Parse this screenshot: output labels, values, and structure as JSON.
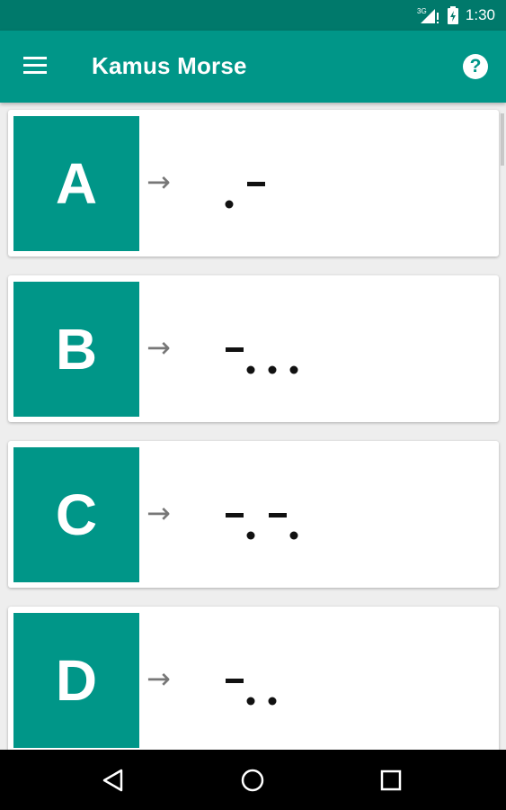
{
  "status_bar": {
    "network": "3G",
    "time": "1:30"
  },
  "app_bar": {
    "title": "Kamus Morse",
    "menu_icon": "hamburger-menu-icon",
    "help_icon": "help-circle-icon",
    "color": "#009688"
  },
  "arrow": "→",
  "entries": [
    {
      "letter": "A",
      "code": ".-"
    },
    {
      "letter": "B",
      "code": "-..."
    },
    {
      "letter": "C",
      "code": "-.-."
    },
    {
      "letter": "D",
      "code": "-.."
    }
  ],
  "nav_bar": {
    "back_icon": "back-triangle-icon",
    "home_icon": "home-circle-icon",
    "recents_icon": "recents-square-icon"
  }
}
